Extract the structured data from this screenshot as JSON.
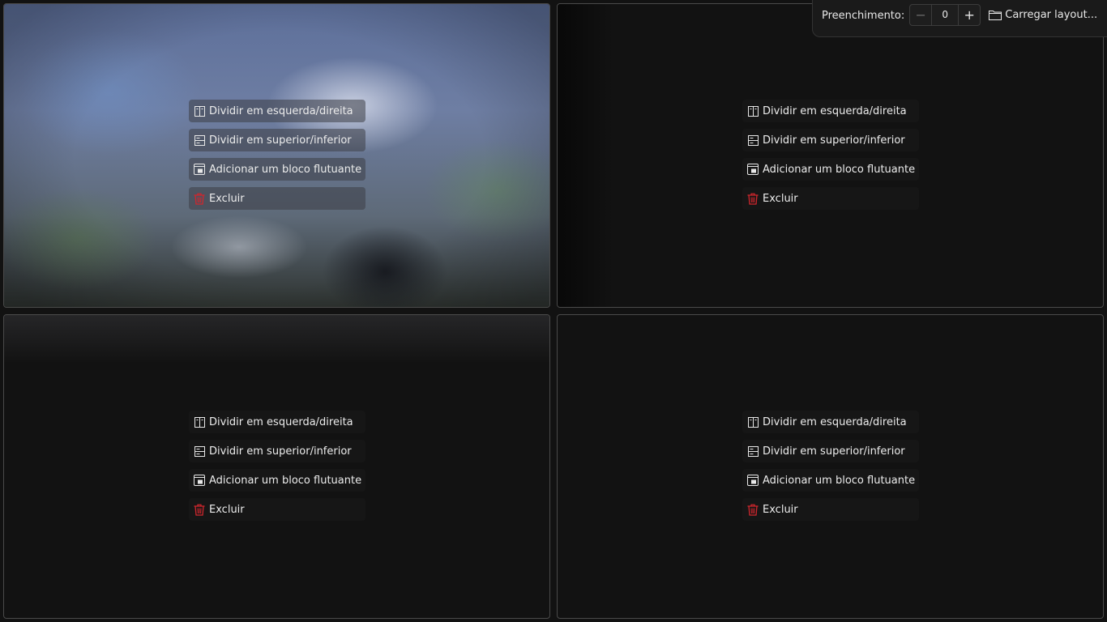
{
  "menu": {
    "split_lr": "Dividir em esquerda/direita",
    "split_tb": "Dividir em superior/inferior",
    "add_floating": "Adicionar um bloco flutuante",
    "delete": "Excluir"
  },
  "toolbar": {
    "padding_label": "Preenchimento:",
    "padding_value": "0",
    "load_layout": "Carregar layout..."
  },
  "icons": {
    "split_lr": "columns-icon",
    "split_tb": "rows-icon",
    "add_floating": "floating-window-icon",
    "delete": "trash-icon",
    "load_layout": "folder-icon",
    "decrement": "minus-icon",
    "increment": "plus-icon"
  },
  "colors": {
    "background": "#121212",
    "delete_accent": "#d0262d",
    "border": "#4a4a4a"
  }
}
